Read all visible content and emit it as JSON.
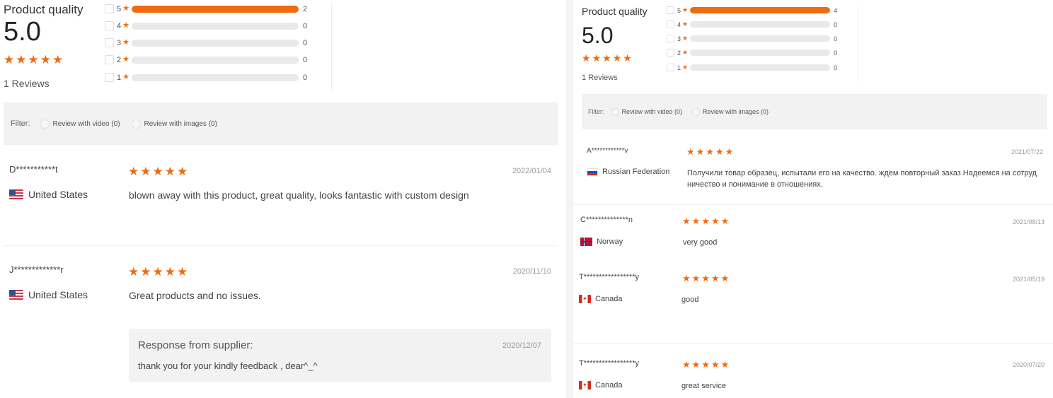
{
  "left": {
    "summary": {
      "title": "Product quality",
      "score": "5.0",
      "reviews_count": "1 Reviews",
      "histogram": [
        {
          "stars": "5",
          "count": "2",
          "fill": 1.0
        },
        {
          "stars": "4",
          "count": "0",
          "fill": 0.0
        },
        {
          "stars": "3",
          "count": "0",
          "fill": 0.0
        },
        {
          "stars": "2",
          "count": "0",
          "fill": 0.0
        },
        {
          "stars": "1",
          "count": "0",
          "fill": 0.0
        }
      ]
    },
    "filter": {
      "label": "Filter:",
      "option_video": "Review with video (0)",
      "option_images": "Review with images (0)"
    },
    "reviews": [
      {
        "name": "D***********t",
        "country": "United States",
        "flag": "us",
        "date": "2022/01/04",
        "stars": 5,
        "text": "blown away with this product, great quality, looks fantastic with custom design"
      },
      {
        "name": "J*************r",
        "country": "United States",
        "flag": "us",
        "date": "2020/11/10",
        "stars": 5,
        "text": "Great products and no issues."
      }
    ],
    "response": {
      "title": "Response from supplier:",
      "date": "2020/12/07",
      "text": "thank you for your kindly feedback , dear^_^"
    }
  },
  "right": {
    "summary": {
      "title": "Product quality",
      "score": "5.0",
      "reviews_count": "1 Reviews",
      "histogram": [
        {
          "stars": "5",
          "count": "4",
          "fill": 1.0
        },
        {
          "stars": "4",
          "count": "0",
          "fill": 0.0
        },
        {
          "stars": "3",
          "count": "0",
          "fill": 0.0
        },
        {
          "stars": "2",
          "count": "0",
          "fill": 0.0
        },
        {
          "stars": "1",
          "count": "0",
          "fill": 0.0
        }
      ]
    },
    "filter": {
      "label": "Filter:",
      "option_video": "Review with video (0)",
      "option_images": "Review with images (0)"
    },
    "reviews": [
      {
        "name": "A************v",
        "country": "Russian Federation",
        "flag": "ru",
        "date": "2021/07/22",
        "stars": 5,
        "text": "Получили товар образец, испытали его на качество. ждем повторный заказ.Надеемся на сотруд ничество и понимание в отношениях."
      },
      {
        "name": "C**************n",
        "country": "Norway",
        "flag": "no",
        "date": "2021/08/13",
        "stars": 5,
        "text": "very good"
      },
      {
        "name": "T*****************y",
        "country": "Canada",
        "flag": "ca",
        "date": "2021/05/19",
        "stars": 5,
        "text": "good"
      },
      {
        "name": "T*****************y",
        "country": "Canada",
        "flag": "ca",
        "date": "2020/07/20",
        "stars": 5,
        "text": "great service"
      }
    ]
  },
  "icons": {
    "star": "star-icon",
    "checkbox": "checkbox-icon",
    "flag": "flag-icon"
  },
  "colors": {
    "accent": "#f06a0f",
    "filter_bg": "#f2f2f2",
    "bar_bg": "#e9e9e9"
  }
}
